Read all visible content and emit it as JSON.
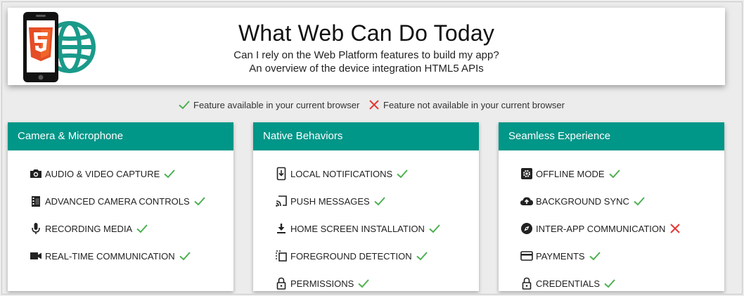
{
  "header": {
    "title": "What Web Can Do Today",
    "subtitle_line1": "Can I rely on the Web Platform features to build my app?",
    "subtitle_line2": "An overview of the device integration HTML5 APIs"
  },
  "legend": {
    "available": "Feature available in your current browser",
    "unavailable": "Feature not available in your current browser"
  },
  "colors": {
    "accent": "#009688",
    "check": "#4caf50",
    "cross": "#e53935",
    "html5": "#e44d26"
  },
  "cards": [
    {
      "title": "Camera & Microphone",
      "features": [
        {
          "label": "AUDIO & VIDEO CAPTURE",
          "icon": "camera-icon",
          "status": "available"
        },
        {
          "label": "ADVANCED CAMERA CONTROLS",
          "icon": "film-icon",
          "status": "available"
        },
        {
          "label": "RECORDING MEDIA",
          "icon": "microphone-icon",
          "status": "available"
        },
        {
          "label": "REAL-TIME COMMUNICATION",
          "icon": "videocam-icon",
          "status": "available"
        }
      ]
    },
    {
      "title": "Native Behaviors",
      "features": [
        {
          "label": "LOCAL NOTIFICATIONS",
          "icon": "phone-download-icon",
          "status": "available"
        },
        {
          "label": "PUSH MESSAGES",
          "icon": "cast-icon",
          "status": "available"
        },
        {
          "label": "HOME SCREEN INSTALLATION",
          "icon": "download-icon",
          "status": "available"
        },
        {
          "label": "FOREGROUND DETECTION",
          "icon": "select-window-icon",
          "status": "available"
        },
        {
          "label": "PERMISSIONS",
          "icon": "lock-icon",
          "status": "available"
        }
      ]
    },
    {
      "title": "Seamless Experience",
      "features": [
        {
          "label": "OFFLINE MODE",
          "icon": "settings-box-icon",
          "status": "available"
        },
        {
          "label": "BACKGROUND SYNC",
          "icon": "cloud-upload-icon",
          "status": "available"
        },
        {
          "label": "INTER-APP COMMUNICATION",
          "icon": "compass-icon",
          "status": "unavailable"
        },
        {
          "label": "PAYMENTS",
          "icon": "credit-card-icon",
          "status": "available"
        },
        {
          "label": "CREDENTIALS",
          "icon": "lock-icon",
          "status": "available"
        }
      ]
    }
  ]
}
